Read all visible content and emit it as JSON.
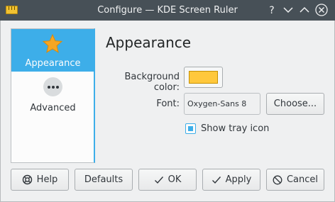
{
  "window": {
    "title": "Configure — KDE Screen Ruler"
  },
  "titlebar_buttons": [
    {
      "name": "help",
      "glyph": "?"
    },
    {
      "name": "minimize",
      "icon": "chevron-down-icon"
    },
    {
      "name": "maximize",
      "icon": "chevron-up-icon"
    },
    {
      "name": "close",
      "icon": "close-icon"
    }
  ],
  "sidebar": {
    "items": [
      {
        "label": "Appearance",
        "icon": "star-icon",
        "selected": true
      },
      {
        "label": "Advanced",
        "icon": "more-dots-icon",
        "selected": false
      }
    ]
  },
  "page": {
    "heading": "Appearance",
    "background_color": {
      "label": "Background color:",
      "value": "#ffc83c"
    },
    "font": {
      "label": "Font:",
      "value": "Oxygen-Sans 8",
      "choose_label": "Choose..."
    },
    "tray": {
      "label": "Show tray icon",
      "checked": true
    }
  },
  "footer": {
    "help": "Help",
    "defaults": "Defaults",
    "ok": "OK",
    "apply": "Apply",
    "cancel": "Cancel"
  },
  "colors": {
    "accent": "#3daee9",
    "titlebar": "#475057",
    "window_bg": "#eff0f1"
  }
}
